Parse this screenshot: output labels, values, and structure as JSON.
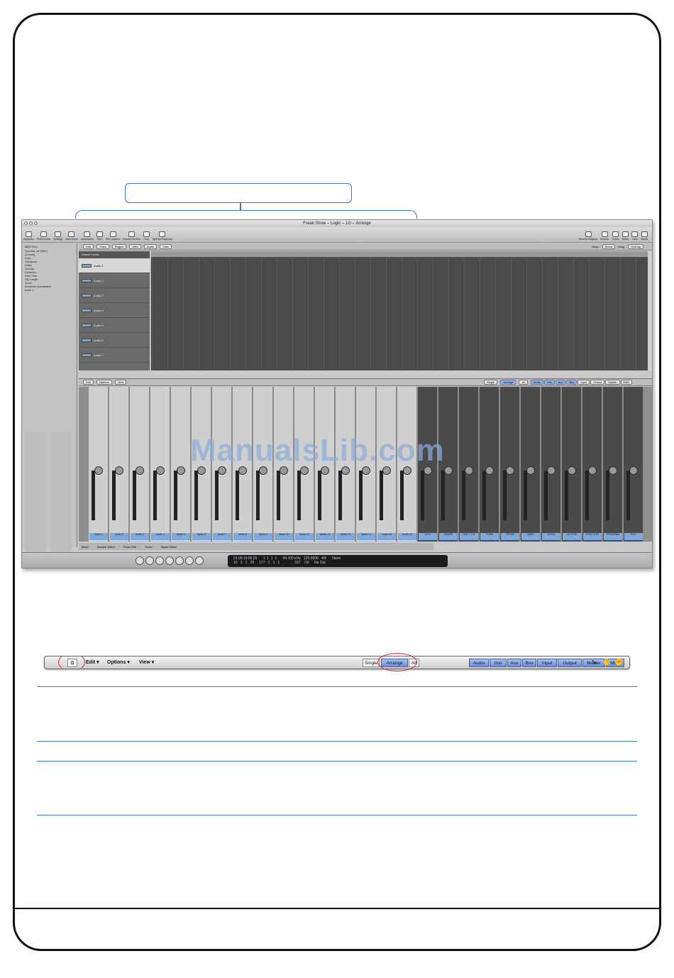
{
  "window": {
    "title": "Freak Show – Logic – 1G – Arrange",
    "toolbar_left": [
      "Inspector",
      "Preferences",
      "Settings",
      "Auto Zoom",
      "Automation",
      "Flex",
      "Set Locators",
      "Repeat Section",
      "Crop",
      "Split by Playhead"
    ],
    "toolbar_right": [
      "Bounce Regions",
      "Bounce",
      "Colors",
      "Notes",
      "Lists",
      "Media"
    ],
    "arrange_menus": [
      "Edit",
      "Track",
      "Region",
      "MIDI",
      "Audio",
      "View"
    ],
    "snap_label": "Snap:",
    "snap_value": "Smart",
    "drag_label": "Drag:",
    "drag_value": "Overlap",
    "inspector_header": "MIDI Thru",
    "inspector_rows": [
      "Quantize: off (3840)",
      "Q-Swing:",
      "Loop:",
      "Transpose:",
      "Delay:",
      "Velocity:",
      "Dynamics:",
      "Gate Time:",
      "Clip Length:",
      "Score:",
      "Advanced Quantization",
      "Audio 1"
    ],
    "global_tracks": "Global Tracks",
    "tracks": [
      "Audio 1",
      "Audio 2",
      "Audio 3",
      "Audio 4",
      "Audio 5",
      "Audio 6",
      "Audio 7"
    ],
    "mixer_menus": [
      "Edit",
      "Options",
      "View"
    ],
    "mixer_views": [
      "Single",
      "Arrange",
      "All"
    ],
    "mixer_filters": [
      "Audio",
      "Inst",
      "Aux",
      "Bus",
      "Input",
      "Output",
      "Master",
      "MIDI"
    ],
    "strips": [
      "Audio 1",
      "Audio 2",
      "Audio 3",
      "Audio 4",
      "Audio 5",
      "Audio 6",
      "Audio 7",
      "Audio 8",
      "Audio 9",
      "Audio 10",
      "Audio 11",
      "Audio 12",
      "Audio 13",
      "Audio 14",
      "Audio 15",
      "Audio 16",
      "KICK",
      "SNARE",
      "OHL + T-B",
      "TOMS",
      "ROOM",
      "BASS",
      "VOCAL",
      "AG GTR",
      "ELEC GTR",
      "PROGRAM",
      "BVO"
    ],
    "inspector_strips": [
      "Audio 1",
      "Stereo Out"
    ],
    "bottom_tabs": [
      "Mixer",
      "Sample Editor",
      "Piano Roll",
      "Score",
      "Hyper Editor"
    ],
    "lcd_line1": "01:00:15:00.25      1  1  1  1      44.100 kHz   120.0000   4/4      None",
    "lcd_line2": "10   3   1   29     177   1   1   1               337    /16     No Out"
  },
  "watermark": "ManualsLib.com",
  "zoom_toolbar": {
    "edit": "Edit",
    "options": "Options",
    "view": "View",
    "single": "Single",
    "arrange": "Arrange",
    "all": "All",
    "filters": [
      "Audio",
      "Inst",
      "Aux",
      "Bus",
      "Input",
      "Output",
      "Master",
      "MIDI"
    ]
  },
  "colors": {
    "callout_blue": "#3a78b8",
    "highlight_red": "#d3262a",
    "filter_blue": "#7f9fdc"
  }
}
